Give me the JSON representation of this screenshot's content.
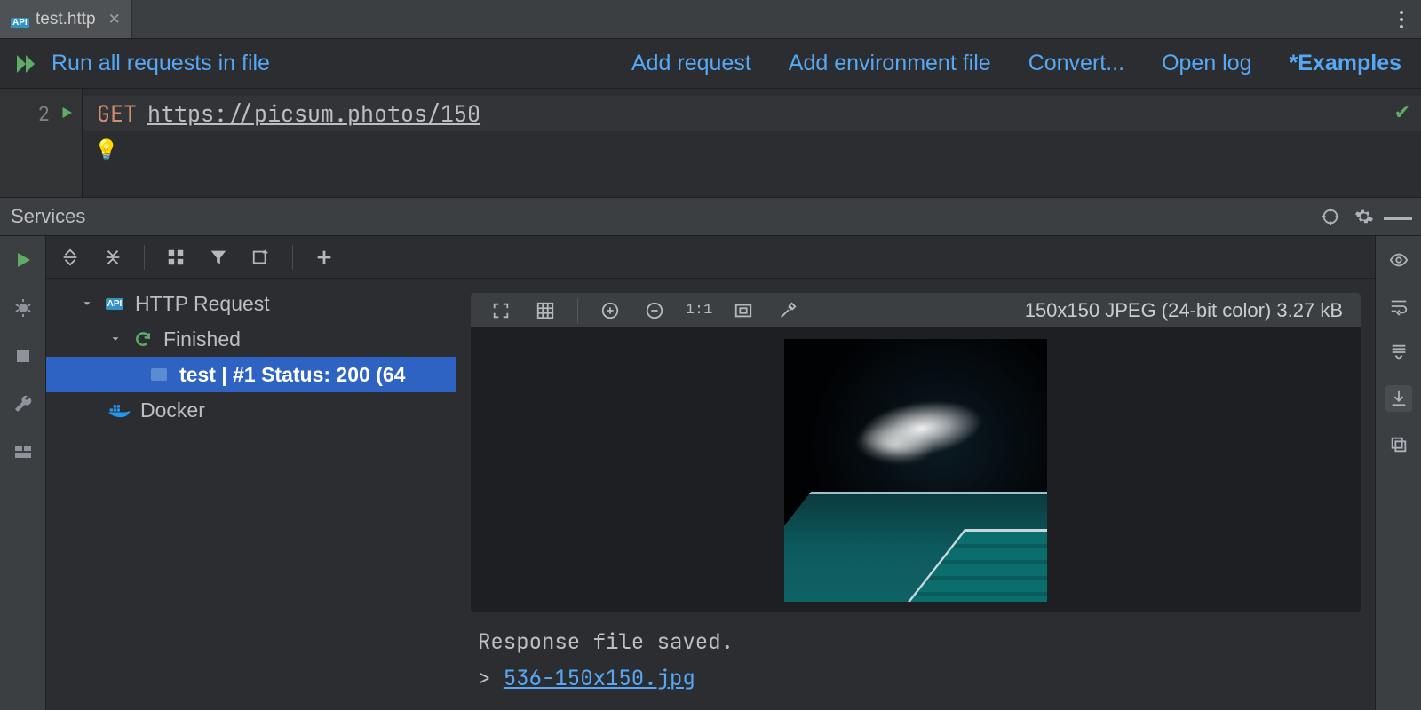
{
  "tab": {
    "title": "test.http"
  },
  "http_toolbar": {
    "run_all": "Run all requests in file",
    "add_request": "Add request",
    "add_env": "Add environment file",
    "convert": "Convert...",
    "open_log": "Open log",
    "examples": "*Examples"
  },
  "editor": {
    "line_number": "2",
    "method": "GET",
    "url": "https://picsum.photos/150"
  },
  "services": {
    "panel_title": "Services",
    "tree": {
      "http_request": "HTTP Request",
      "finished": "Finished",
      "selected_item": "test  |  #1 Status: 200 (64",
      "docker": "Docker"
    }
  },
  "viewer": {
    "image_info": "150x150 JPEG (24-bit color) 3.27 kB",
    "one_to_one": "1:1"
  },
  "console": {
    "line1": "Response file saved.",
    "prompt": "> ",
    "file": "536-150x150.jpg"
  }
}
